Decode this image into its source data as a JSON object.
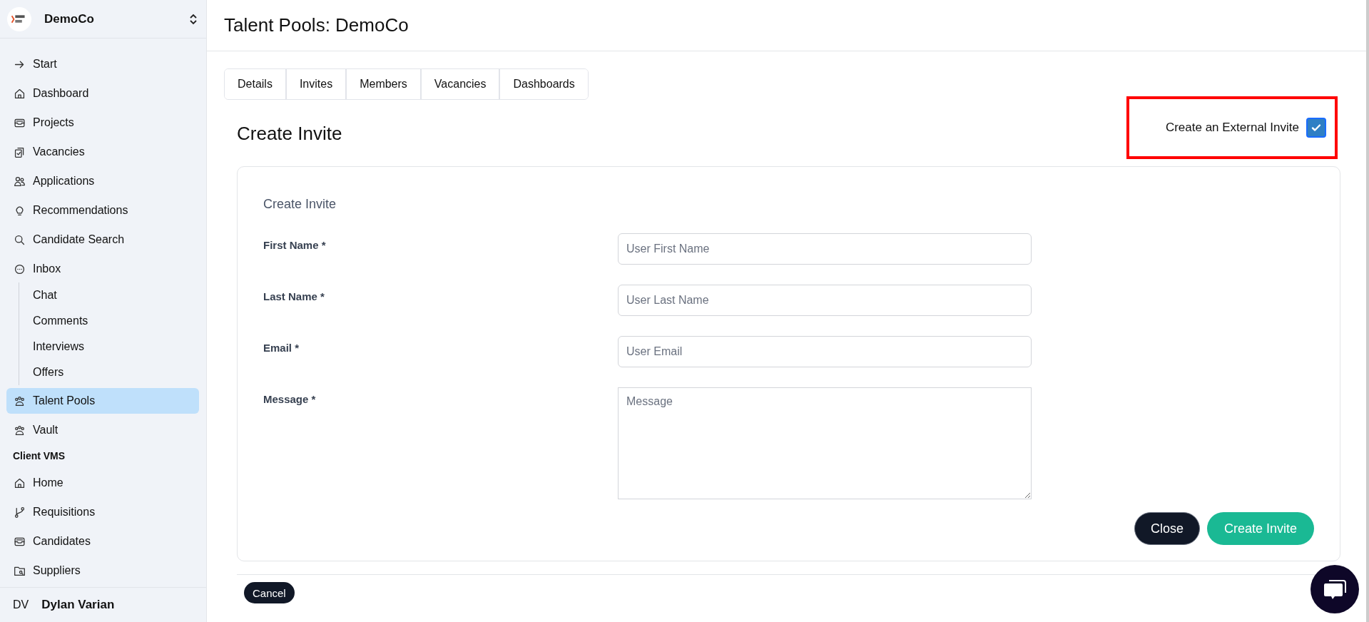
{
  "org": {
    "name": "DemoCo"
  },
  "sidebar": {
    "sections": [
      {
        "items": [
          {
            "label": "Start",
            "selected": false
          },
          {
            "label": "Dashboard",
            "selected": false
          },
          {
            "label": "Projects",
            "selected": false
          },
          {
            "label": "Vacancies",
            "selected": false
          },
          {
            "label": "Applications",
            "selected": false
          },
          {
            "label": "Recommendations",
            "selected": false
          },
          {
            "label": "Candidate Search",
            "selected": false
          },
          {
            "label": "Inbox",
            "selected": false,
            "children": [
              {
                "label": "Chat",
                "selected": false
              },
              {
                "label": "Comments",
                "selected": false
              },
              {
                "label": "Interviews",
                "selected": false
              },
              {
                "label": "Offers",
                "selected": false
              }
            ]
          },
          {
            "label": "Talent Pools",
            "selected": true
          },
          {
            "label": "Vault",
            "selected": false
          }
        ]
      },
      {
        "title": "Client VMS",
        "items": [
          {
            "label": "Home",
            "selected": false
          },
          {
            "label": "Requisitions",
            "selected": false
          },
          {
            "label": "Candidates",
            "selected": false
          },
          {
            "label": "Suppliers",
            "selected": false
          }
        ]
      }
    ]
  },
  "user": {
    "initials": "DV",
    "name": "Dylan Varian"
  },
  "page": {
    "title": "Talent Pools: DemoCo"
  },
  "tabs": [
    {
      "label": "Details",
      "selected": false
    },
    {
      "label": "Invites",
      "selected": false
    },
    {
      "label": "Members",
      "selected": false
    },
    {
      "label": "Vacancies",
      "selected": false
    },
    {
      "label": "Dashboards",
      "selected": false
    }
  ],
  "form": {
    "heading": "Create Invite",
    "external_invite": {
      "label": "Create an External Invite",
      "checked": true
    },
    "card_title": "Create Invite",
    "fields": [
      {
        "kind": "input",
        "label": "First Name *",
        "placeholder": "User First Name"
      },
      {
        "kind": "input",
        "label": "Last Name *",
        "placeholder": "User Last Name"
      },
      {
        "kind": "input",
        "label": "Email *",
        "placeholder": "User Email"
      },
      {
        "kind": "textarea",
        "label": "Message *",
        "placeholder": "Message"
      }
    ],
    "close_button": "Close",
    "submit_button": "Create Invite"
  },
  "cancel_button": "Cancel"
}
